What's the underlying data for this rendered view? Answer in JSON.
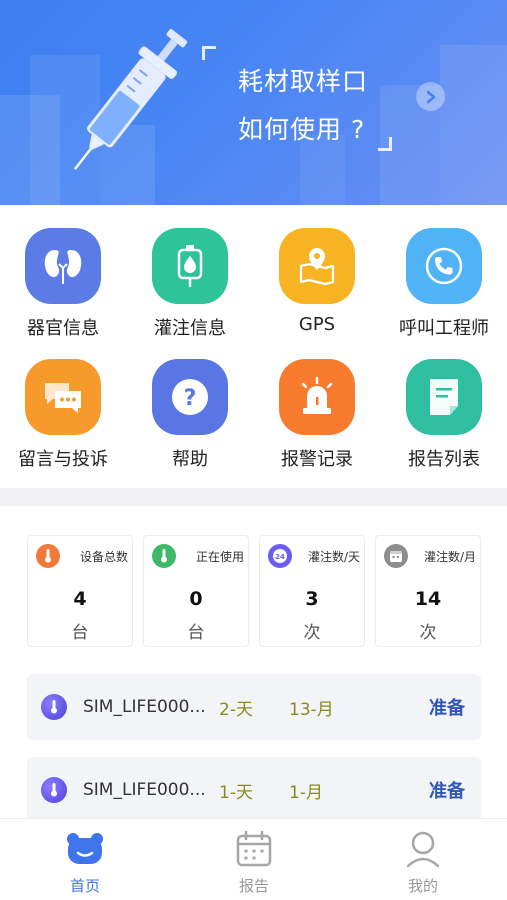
{
  "banner": {
    "title": "耗材取样口",
    "subtitle": "如何使用 ?",
    "next_icon": "chevron-right-icon"
  },
  "grid": {
    "items": [
      {
        "label": "器官信息",
        "icon": "kidney-icon",
        "color": "#5b7ce6"
      },
      {
        "label": "灌注信息",
        "icon": "iv-bag-icon",
        "color": "#2fc39a"
      },
      {
        "label": "GPS",
        "icon": "map-pin-icon",
        "color": "#f7b322"
      },
      {
        "label": "呼叫工程师",
        "icon": "phone-icon",
        "color": "#4fb3f5"
      },
      {
        "label": "留言与投诉",
        "icon": "chat-icon",
        "color": "#f69a2c"
      },
      {
        "label": "帮助",
        "icon": "help-icon",
        "color": "#5a76e4"
      },
      {
        "label": "报警记录",
        "icon": "alarm-icon",
        "color": "#f77a2d"
      },
      {
        "label": "报告列表",
        "icon": "document-icon",
        "color": "#2fbfa0"
      }
    ]
  },
  "stats": [
    {
      "label": "设备总数",
      "value": "4",
      "unit": "台",
      "icon": "thermometer-icon",
      "color": "#f07a3a"
    },
    {
      "label": "正在使用",
      "value": "0",
      "unit": "台",
      "icon": "thermometer-icon",
      "color": "#3fb86a"
    },
    {
      "label": "灌注数/天",
      "value": "3",
      "unit": "次",
      "icon": "clock-24-icon",
      "color": "#6a5cf0"
    },
    {
      "label": "灌注数/月",
      "value": "14",
      "unit": "次",
      "icon": "calendar-icon",
      "color": "#8d8d8d"
    }
  ],
  "devices": [
    {
      "name": "SIM_LIFE000...",
      "day": "2-天",
      "month": "13-月",
      "status": "准备"
    },
    {
      "name": "SIM_LIFE000...",
      "day": "1-天",
      "month": "1-月",
      "status": "准备"
    }
  ],
  "nav": [
    {
      "label": "首页",
      "icon": "home-face-icon",
      "active": true
    },
    {
      "label": "报告",
      "icon": "calendar-report-icon",
      "active": false
    },
    {
      "label": "我的",
      "icon": "person-icon",
      "active": false
    }
  ],
  "colors": {
    "accent": "#3f74ea",
    "status": "#2f55b8",
    "count": "#8a8a1c"
  }
}
